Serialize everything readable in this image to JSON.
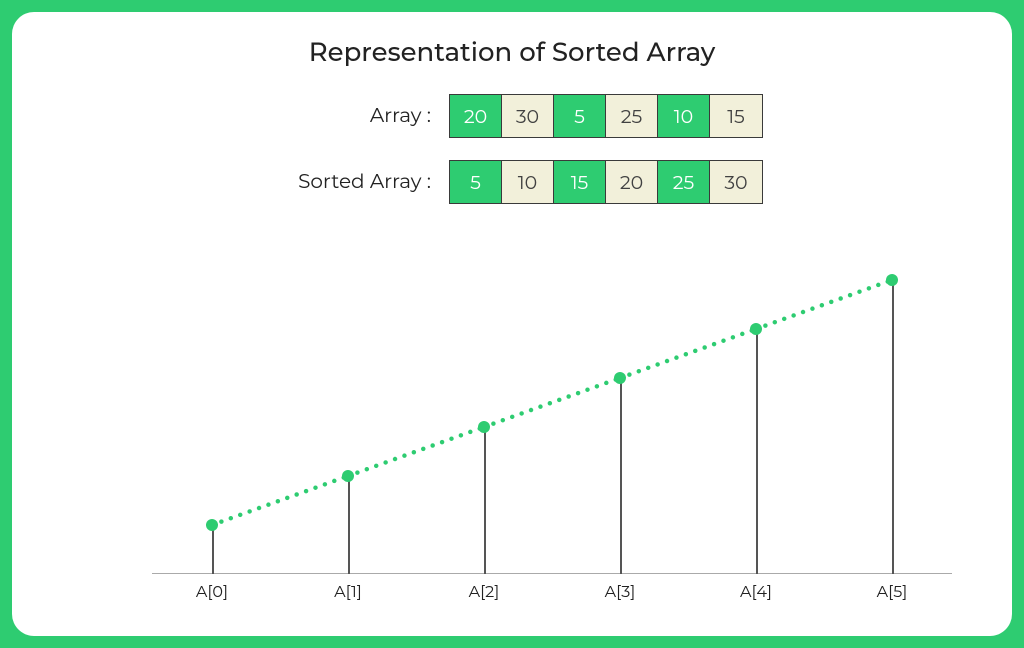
{
  "title": "Representation of Sorted Array",
  "arrayLabel": "Array :",
  "sortedLabel": "Sorted Array :",
  "array": [
    20,
    30,
    5,
    25,
    10,
    15
  ],
  "sorted": [
    5,
    10,
    15,
    20,
    25,
    30
  ],
  "colors": {
    "accent": "#2ecc71",
    "cream": "#f2f0da"
  },
  "chart_data": {
    "type": "bar",
    "categories": [
      "A[0]",
      "A[1]",
      "A[2]",
      "A[3]",
      "A[4]",
      "A[5]"
    ],
    "values": [
      5,
      10,
      15,
      20,
      25,
      30
    ],
    "title": "Representation of Sorted Array",
    "xlabel": "",
    "ylabel": "",
    "ylim": [
      0,
      30
    ]
  }
}
